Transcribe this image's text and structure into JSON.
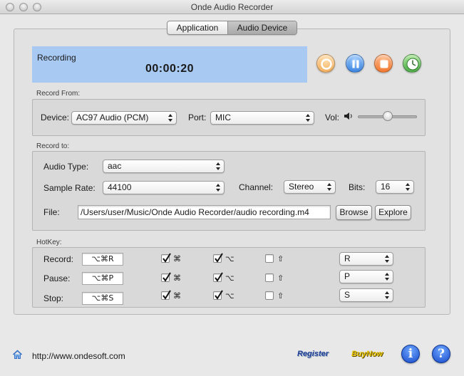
{
  "window": {
    "title": "Onde Audio Recorder"
  },
  "tabs": [
    {
      "label": "Application",
      "selected": false
    },
    {
      "label": "Audio Device",
      "selected": true
    }
  ],
  "recording": {
    "label": "Recording",
    "time": "00:00:20",
    "background_color": "#a8c9f2"
  },
  "controls": {
    "record_icon": "record-icon",
    "pause_icon": "pause-icon",
    "stop_icon": "stop-icon",
    "schedule_icon": "clock-icon",
    "record_color": "#f0a24a",
    "pause_color": "#2a7ee0",
    "stop_color": "#f06a12",
    "schedule_color": "#3aa23a"
  },
  "record_from": {
    "section_label": "Record From:",
    "device_label": "Device:",
    "device_value": "AC97 Audio (PCM)",
    "port_label": "Port:",
    "port_value": "MIC",
    "vol_label": "Vol:",
    "volume_level": 0.5
  },
  "record_to": {
    "section_label": "Record to:",
    "audio_type_label": "Audio Type:",
    "audio_type_value": "aac",
    "sample_rate_label": "Sample Rate:",
    "sample_rate_value": "44100",
    "channel_label": "Channel:",
    "channel_value": "Stereo",
    "bits_label": "Bits:",
    "bits_value": "16",
    "file_label": "File:",
    "file_value": "/Users/user/Music/Onde Audio Recorder/audio recording.m4",
    "browse_label": "Browse",
    "explore_label": "Explore"
  },
  "hotkey": {
    "section_label": "HotKey:",
    "command_glyph": "⌘",
    "option_glyph": "⌥",
    "shift_glyph": "⇧",
    "rows": [
      {
        "label": "Record:",
        "shortcut": "⌥⌘R",
        "cmd": true,
        "opt": true,
        "shift": false,
        "key": "R"
      },
      {
        "label": "Pause:",
        "shortcut": "⌥⌘P",
        "cmd": true,
        "opt": true,
        "shift": false,
        "key": "P"
      },
      {
        "label": "Stop:",
        "shortcut": "⌥⌘S",
        "cmd": true,
        "opt": true,
        "shift": false,
        "key": "S"
      }
    ]
  },
  "footer": {
    "url": "http://www.ondesoft.com",
    "register_label": "Register",
    "buynow_label": "BuyNow",
    "info_glyph": "i",
    "help_glyph": "?"
  }
}
